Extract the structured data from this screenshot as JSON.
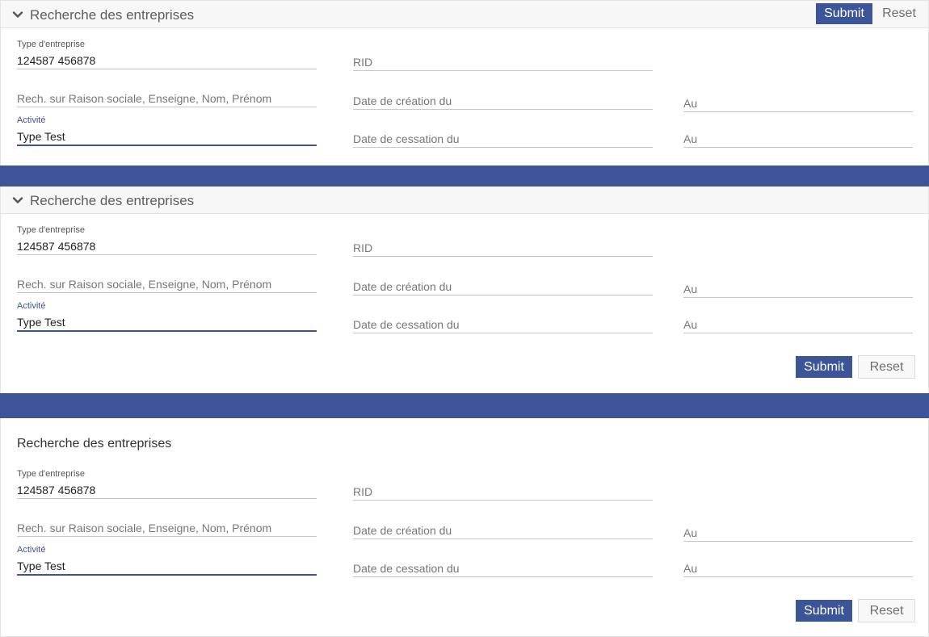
{
  "panels": [
    {
      "title": "Recherche des entreprises",
      "type_label": "Type d'entreprise",
      "type_value": "124587 456878",
      "rid_placeholder": "RID",
      "raison_placeholder": "Rech. sur Raison sociale, Enseigne, Nom, Prénom",
      "creation_placeholder": "Date de création du",
      "au1_placeholder": "Au",
      "activite_label": "Activité",
      "activite_value": "Type Test",
      "cessation_placeholder": "Date de cessation du",
      "au2_placeholder": "Au",
      "submit_label": "Submit",
      "reset_label": "Reset"
    },
    {
      "title": "Recherche des entreprises",
      "type_label": "Type d'entreprise",
      "type_value": "124587 456878",
      "rid_placeholder": "RID",
      "raison_placeholder": "Rech. sur Raison sociale, Enseigne, Nom, Prénom",
      "creation_placeholder": "Date de création du",
      "au1_placeholder": "Au",
      "activite_label": "Activité",
      "activite_value": "Type Test",
      "cessation_placeholder": "Date de cessation du",
      "au2_placeholder": "Au",
      "submit_label": "Submit",
      "reset_label": "Reset"
    },
    {
      "title": "Recherche des entreprises",
      "type_label": "Type d'entreprise",
      "type_value": "124587 456878",
      "rid_placeholder": "RID",
      "raison_placeholder": "Rech. sur Raison sociale, Enseigne, Nom, Prénom",
      "creation_placeholder": "Date de création du",
      "au1_placeholder": "Au",
      "activite_label": "Activité",
      "activite_value": "Type Test",
      "cessation_placeholder": "Date de cessation du",
      "au2_placeholder": "Au",
      "submit_label": "Submit",
      "reset_label": "Reset"
    }
  ],
  "icons": {
    "collapse": "chevron-down-icon"
  },
  "colors": {
    "primary": "#3c5599",
    "header_bg": "#f7f7f7",
    "reset_text": "#6e6e6e"
  }
}
